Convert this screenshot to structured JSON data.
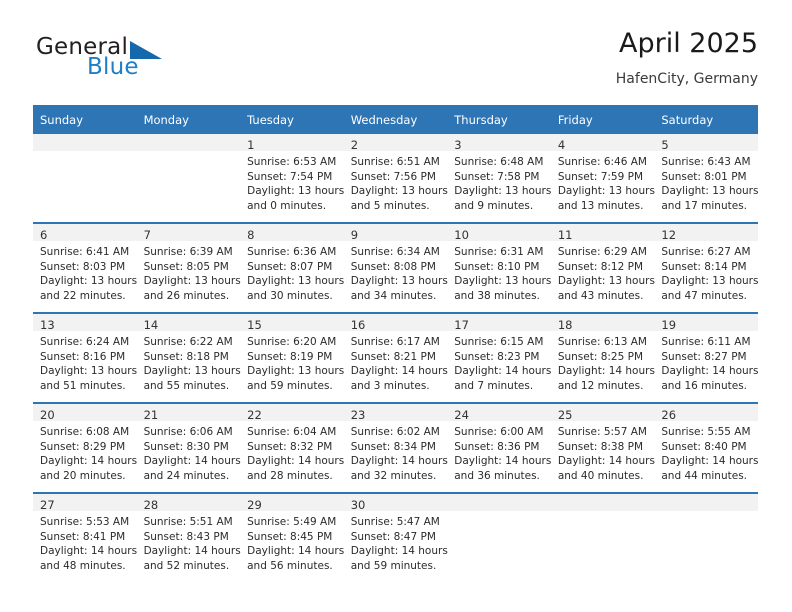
{
  "brand": {
    "name_top": "General",
    "name_bottom": "Blue",
    "accent_color": "#1f7ec4",
    "triangle_color": "#1668ad"
  },
  "header": {
    "title": "April 2025",
    "subtitle": "HafenCity, Germany"
  },
  "calendar": {
    "header_color": "#2e75b6",
    "daynum_band_color": "#f2f2f2",
    "weekday_headers": [
      "Sunday",
      "Monday",
      "Tuesday",
      "Wednesday",
      "Thursday",
      "Friday",
      "Saturday"
    ],
    "weeks": [
      [
        {
          "empty": true
        },
        {
          "empty": true
        },
        {
          "day": "1",
          "sunrise": "Sunrise: 6:53 AM",
          "sunset": "Sunset: 7:54 PM",
          "daylight1": "Daylight: 13 hours",
          "daylight2": "and 0 minutes."
        },
        {
          "day": "2",
          "sunrise": "Sunrise: 6:51 AM",
          "sunset": "Sunset: 7:56 PM",
          "daylight1": "Daylight: 13 hours",
          "daylight2": "and 5 minutes."
        },
        {
          "day": "3",
          "sunrise": "Sunrise: 6:48 AM",
          "sunset": "Sunset: 7:58 PM",
          "daylight1": "Daylight: 13 hours",
          "daylight2": "and 9 minutes."
        },
        {
          "day": "4",
          "sunrise": "Sunrise: 6:46 AM",
          "sunset": "Sunset: 7:59 PM",
          "daylight1": "Daylight: 13 hours",
          "daylight2": "and 13 minutes."
        },
        {
          "day": "5",
          "sunrise": "Sunrise: 6:43 AM",
          "sunset": "Sunset: 8:01 PM",
          "daylight1": "Daylight: 13 hours",
          "daylight2": "and 17 minutes."
        }
      ],
      [
        {
          "day": "6",
          "sunrise": "Sunrise: 6:41 AM",
          "sunset": "Sunset: 8:03 PM",
          "daylight1": "Daylight: 13 hours",
          "daylight2": "and 22 minutes."
        },
        {
          "day": "7",
          "sunrise": "Sunrise: 6:39 AM",
          "sunset": "Sunset: 8:05 PM",
          "daylight1": "Daylight: 13 hours",
          "daylight2": "and 26 minutes."
        },
        {
          "day": "8",
          "sunrise": "Sunrise: 6:36 AM",
          "sunset": "Sunset: 8:07 PM",
          "daylight1": "Daylight: 13 hours",
          "daylight2": "and 30 minutes."
        },
        {
          "day": "9",
          "sunrise": "Sunrise: 6:34 AM",
          "sunset": "Sunset: 8:08 PM",
          "daylight1": "Daylight: 13 hours",
          "daylight2": "and 34 minutes."
        },
        {
          "day": "10",
          "sunrise": "Sunrise: 6:31 AM",
          "sunset": "Sunset: 8:10 PM",
          "daylight1": "Daylight: 13 hours",
          "daylight2": "and 38 minutes."
        },
        {
          "day": "11",
          "sunrise": "Sunrise: 6:29 AM",
          "sunset": "Sunset: 8:12 PM",
          "daylight1": "Daylight: 13 hours",
          "daylight2": "and 43 minutes."
        },
        {
          "day": "12",
          "sunrise": "Sunrise: 6:27 AM",
          "sunset": "Sunset: 8:14 PM",
          "daylight1": "Daylight: 13 hours",
          "daylight2": "and 47 minutes."
        }
      ],
      [
        {
          "day": "13",
          "sunrise": "Sunrise: 6:24 AM",
          "sunset": "Sunset: 8:16 PM",
          "daylight1": "Daylight: 13 hours",
          "daylight2": "and 51 minutes."
        },
        {
          "day": "14",
          "sunrise": "Sunrise: 6:22 AM",
          "sunset": "Sunset: 8:18 PM",
          "daylight1": "Daylight: 13 hours",
          "daylight2": "and 55 minutes."
        },
        {
          "day": "15",
          "sunrise": "Sunrise: 6:20 AM",
          "sunset": "Sunset: 8:19 PM",
          "daylight1": "Daylight: 13 hours",
          "daylight2": "and 59 minutes."
        },
        {
          "day": "16",
          "sunrise": "Sunrise: 6:17 AM",
          "sunset": "Sunset: 8:21 PM",
          "daylight1": "Daylight: 14 hours",
          "daylight2": "and 3 minutes."
        },
        {
          "day": "17",
          "sunrise": "Sunrise: 6:15 AM",
          "sunset": "Sunset: 8:23 PM",
          "daylight1": "Daylight: 14 hours",
          "daylight2": "and 7 minutes."
        },
        {
          "day": "18",
          "sunrise": "Sunrise: 6:13 AM",
          "sunset": "Sunset: 8:25 PM",
          "daylight1": "Daylight: 14 hours",
          "daylight2": "and 12 minutes."
        },
        {
          "day": "19",
          "sunrise": "Sunrise: 6:11 AM",
          "sunset": "Sunset: 8:27 PM",
          "daylight1": "Daylight: 14 hours",
          "daylight2": "and 16 minutes."
        }
      ],
      [
        {
          "day": "20",
          "sunrise": "Sunrise: 6:08 AM",
          "sunset": "Sunset: 8:29 PM",
          "daylight1": "Daylight: 14 hours",
          "daylight2": "and 20 minutes."
        },
        {
          "day": "21",
          "sunrise": "Sunrise: 6:06 AM",
          "sunset": "Sunset: 8:30 PM",
          "daylight1": "Daylight: 14 hours",
          "daylight2": "and 24 minutes."
        },
        {
          "day": "22",
          "sunrise": "Sunrise: 6:04 AM",
          "sunset": "Sunset: 8:32 PM",
          "daylight1": "Daylight: 14 hours",
          "daylight2": "and 28 minutes."
        },
        {
          "day": "23",
          "sunrise": "Sunrise: 6:02 AM",
          "sunset": "Sunset: 8:34 PM",
          "daylight1": "Daylight: 14 hours",
          "daylight2": "and 32 minutes."
        },
        {
          "day": "24",
          "sunrise": "Sunrise: 6:00 AM",
          "sunset": "Sunset: 8:36 PM",
          "daylight1": "Daylight: 14 hours",
          "daylight2": "and 36 minutes."
        },
        {
          "day": "25",
          "sunrise": "Sunrise: 5:57 AM",
          "sunset": "Sunset: 8:38 PM",
          "daylight1": "Daylight: 14 hours",
          "daylight2": "and 40 minutes."
        },
        {
          "day": "26",
          "sunrise": "Sunrise: 5:55 AM",
          "sunset": "Sunset: 8:40 PM",
          "daylight1": "Daylight: 14 hours",
          "daylight2": "and 44 minutes."
        }
      ],
      [
        {
          "day": "27",
          "sunrise": "Sunrise: 5:53 AM",
          "sunset": "Sunset: 8:41 PM",
          "daylight1": "Daylight: 14 hours",
          "daylight2": "and 48 minutes."
        },
        {
          "day": "28",
          "sunrise": "Sunrise: 5:51 AM",
          "sunset": "Sunset: 8:43 PM",
          "daylight1": "Daylight: 14 hours",
          "daylight2": "and 52 minutes."
        },
        {
          "day": "29",
          "sunrise": "Sunrise: 5:49 AM",
          "sunset": "Sunset: 8:45 PM",
          "daylight1": "Daylight: 14 hours",
          "daylight2": "and 56 minutes."
        },
        {
          "day": "30",
          "sunrise": "Sunrise: 5:47 AM",
          "sunset": "Sunset: 8:47 PM",
          "daylight1": "Daylight: 14 hours",
          "daylight2": "and 59 minutes."
        },
        {
          "empty": true
        },
        {
          "empty": true
        },
        {
          "empty": true
        }
      ]
    ]
  }
}
